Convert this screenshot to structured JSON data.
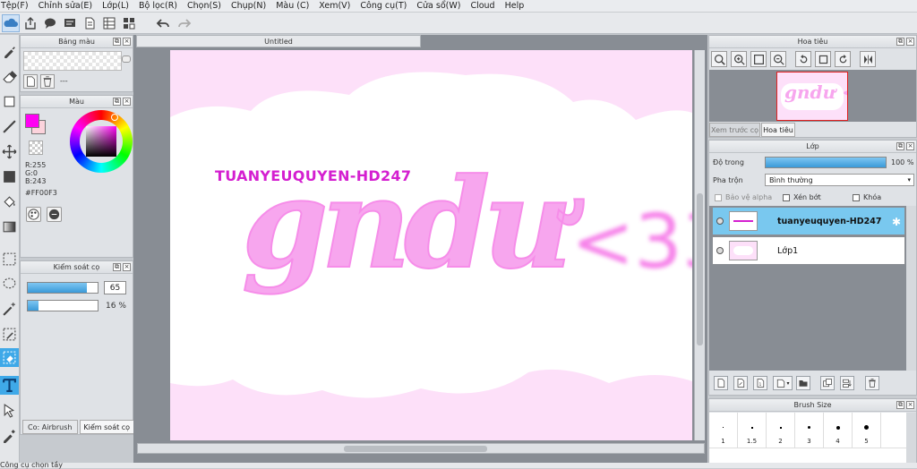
{
  "menu": [
    "Tệp(F)",
    "Chỉnh sửa(E)",
    "Lớp(L)",
    "Bộ lọc(R)",
    "Chọn(S)",
    "Chụp(N)",
    "Màu (C)",
    "Xem(V)",
    "Công cụ(T)",
    "Cửa sổ(W)",
    "Cloud",
    "Help"
  ],
  "left_panels": {
    "bangmau_title": "Bảng màu",
    "bangmau_dash": "---",
    "mau_title": "Màu",
    "color_readout": {
      "r": "R:255",
      "g": "G:0",
      "b": "B:243",
      "hex": "#FF00F3"
    },
    "kiemsoat_title": "Kiểm soát cọ",
    "size_value": "65",
    "opacity_value": "16 %",
    "size_level": 0.85,
    "opacity_level": 0.16,
    "tab_airbrush": "Co: Airbrush",
    "tab_kiemsoat": "Kiểm soát cọ"
  },
  "document": {
    "tab_title": "Untitled",
    "watermark": "TUANYEUQUYEN-HD247",
    "main_text": "gndư",
    "heart_text": "<33"
  },
  "navigator": {
    "title": "Hoa tiêu",
    "tab_preview": "Xem trước cọ",
    "tab_nav": "Hoa tiêu",
    "thumb_text": "gndư <3"
  },
  "layers": {
    "title": "Lớp",
    "opacity_label": "Độ trong",
    "opacity_value": "100 %",
    "opacity_level": 1.0,
    "blend_label": "Pha trộn",
    "blend_value": "Bình thường",
    "protect_alpha": "Bảo vệ alpha",
    "clip": "Xén bớt",
    "lock": "Khóa",
    "items": [
      {
        "name": "tuanyeuquyen-HD247",
        "selected": true
      },
      {
        "name": "Lớp1",
        "selected": false
      }
    ]
  },
  "brush_size": {
    "title": "Brush Size",
    "sizes": [
      "1",
      "1.5",
      "2",
      "3",
      "4",
      "5"
    ]
  },
  "status": "Công cụ chọn tầy",
  "colors": {
    "accent": "#3fa9e8",
    "fg": "#ff00f3",
    "canvas_bg": "#fde0f9",
    "letter": "#f7a6ee"
  }
}
